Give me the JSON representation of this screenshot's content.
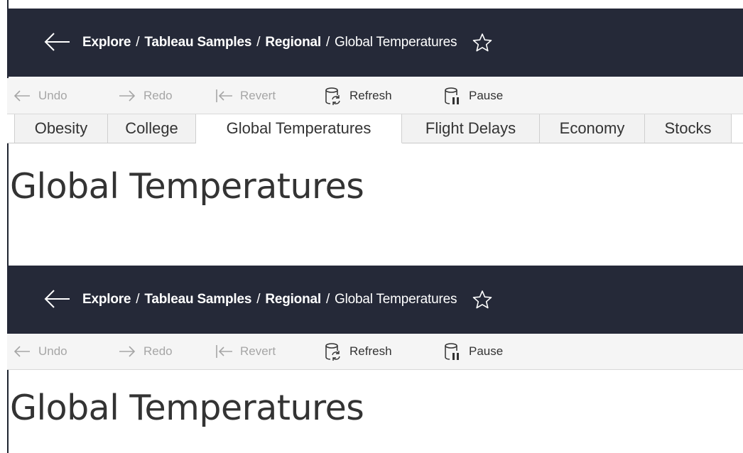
{
  "breadcrumb": {
    "items": [
      "Explore",
      "Tableau Samples",
      "Regional"
    ],
    "separator": "/",
    "current": "Global Temperatures"
  },
  "toolbar": {
    "undo": "Undo",
    "redo": "Redo",
    "revert": "Revert",
    "refresh": "Refresh",
    "pause": "Pause"
  },
  "tabs": [
    "Obesity",
    "College",
    "Global Temperatures",
    "Flight Delays",
    "Economy",
    "Stocks"
  ],
  "active_tab": "Global Temperatures",
  "sheet_title": "Global Temperatures",
  "icons": {
    "back": "back-arrow-icon",
    "star": "star-icon",
    "undo": "undo-arrow-icon",
    "redo": "redo-arrow-icon",
    "revert": "revert-icon",
    "refresh": "refresh-database-icon",
    "pause": "pause-database-icon"
  },
  "colors": {
    "topbar_bg": "#252938",
    "toolbar_bg": "#f5f5f5",
    "disabled_text": "#a6a6a6",
    "text": "#333333"
  }
}
